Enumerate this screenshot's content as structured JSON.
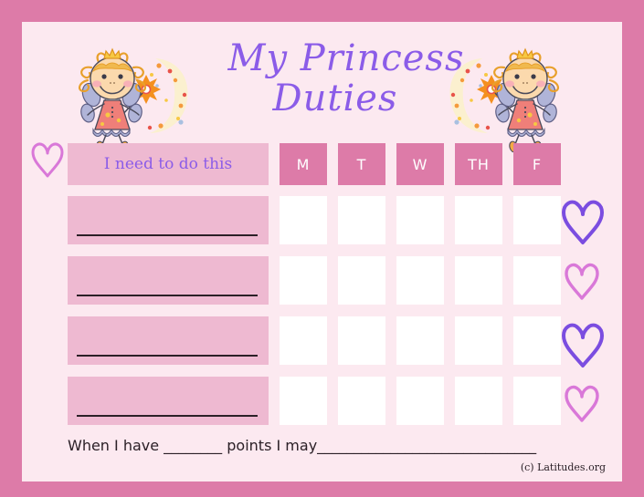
{
  "title": {
    "line1": "My Princess",
    "line2": "Duties"
  },
  "colors": {
    "border_pink": "#dd7ba8",
    "background_pink": "#fce9f0",
    "row_pink": "#eeb9d1",
    "header_pink": "#dd7ba8",
    "title_purple": "#8b5ce8",
    "heart_purple": "#7b4de0",
    "heart_pink": "#d978d8",
    "cell_white": "#ffffff",
    "line_dark": "#2b2027"
  },
  "table": {
    "task_column_header": "I need to do this",
    "day_headers": [
      "M",
      "T",
      "W",
      "TH",
      "F"
    ],
    "task_rows": [
      {
        "label": "",
        "checks": [
          "",
          "",
          "",
          "",
          ""
        ]
      },
      {
        "label": "",
        "checks": [
          "",
          "",
          "",
          "",
          ""
        ]
      },
      {
        "label": "",
        "checks": [
          "",
          "",
          "",
          "",
          ""
        ]
      },
      {
        "label": "",
        "checks": [
          "",
          "",
          "",
          "",
          ""
        ]
      }
    ]
  },
  "footer": {
    "text": "When I have ________ points I may______________________________"
  },
  "credit": "(c) Latitudes.org",
  "decorations": {
    "hearts": [
      {
        "name": "heart-left-header",
        "color": "#d978d8",
        "size": "small"
      },
      {
        "name": "heart-right-1",
        "color": "#7b4de0",
        "size": "large"
      },
      {
        "name": "heart-right-2",
        "color": "#d978d8",
        "size": "small"
      },
      {
        "name": "heart-right-3",
        "color": "#7b4de0",
        "size": "large"
      },
      {
        "name": "heart-right-4",
        "color": "#d978d8",
        "size": "small"
      }
    ],
    "fairies": [
      "fairy-left",
      "fairy-right"
    ]
  }
}
